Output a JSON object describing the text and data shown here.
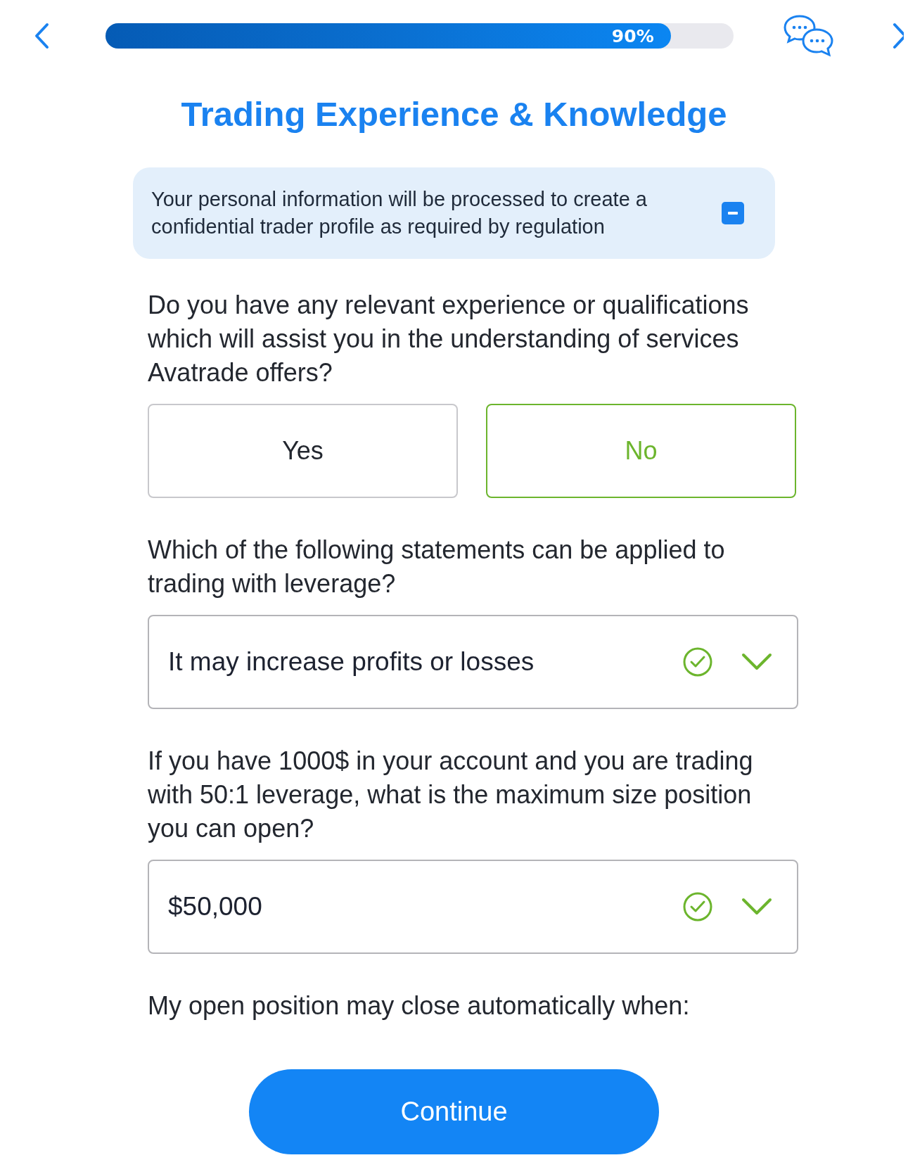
{
  "progress": {
    "level": 0.9,
    "label": "90%"
  },
  "title": "Trading Experience & Knowledge",
  "notice": {
    "text": "Your personal information will be processed to create a confidential trader profile as required by regulation",
    "expanded": true
  },
  "questions": [
    {
      "kind": "choice",
      "text": "Do you have any relevant experience or qualifications which will assist you in the understanding of services Avatrade offers?",
      "options": [
        {
          "label": "Yes",
          "selected": false
        },
        {
          "label": "No",
          "selected": true
        }
      ]
    },
    {
      "kind": "select",
      "text": "Which of the following statements can be applied to trading with leverage?",
      "value": "It may increase profits or losses",
      "valid": true
    },
    {
      "kind": "select",
      "text": "If you have 1000$ in your account and you are trading with 50:1 leverage, what is the maximum size position you can open?",
      "value": "$50,000",
      "valid": true
    },
    {
      "kind": "partial",
      "text": "My open position may close automatically when:"
    }
  ],
  "continue_button": "Continue"
}
